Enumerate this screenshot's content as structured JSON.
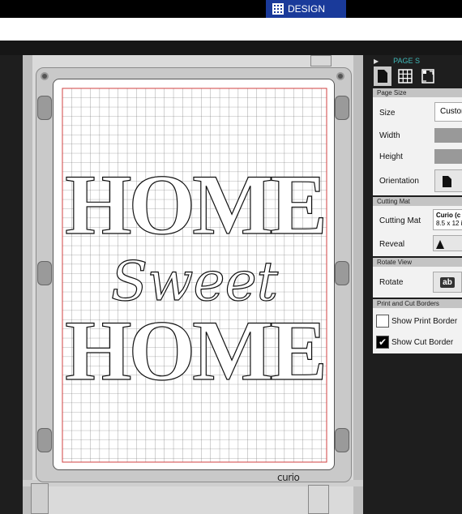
{
  "header": {
    "design_tab_label": "DESIGN"
  },
  "mat": {
    "brand_label": "curio",
    "design_lines": [
      "HOME",
      "Sweet",
      "HOME"
    ]
  },
  "panel": {
    "title": "PAGE S",
    "page_size": {
      "section_label": "Page Size",
      "size_label": "Size",
      "size_value": "Custom",
      "width_label": "Width",
      "height_label": "Height",
      "orientation_label": "Orientation"
    },
    "cutting_mat": {
      "section_label": "Cutting Mat",
      "mat_label": "Cutting Mat",
      "mat_value_line1": "Curio (c",
      "mat_value_line2": "8.5 x 12 i",
      "reveal_label": "Reveal"
    },
    "rotate_view": {
      "section_label": "Rotate View",
      "rotate_label": "Rotate",
      "rotate_button_text": "ab"
    },
    "borders": {
      "section_label": "Print and Cut Borders",
      "show_print_border_label": "Show Print Border",
      "show_print_border_checked": false,
      "show_cut_border_label": "Show Cut Border",
      "show_cut_border_checked": true
    }
  },
  "colors": {
    "design_tab": "#1a3a9a",
    "panel_accent": "#3fb8b8",
    "cut_border": "#d04040",
    "grid_line": "#666666"
  }
}
